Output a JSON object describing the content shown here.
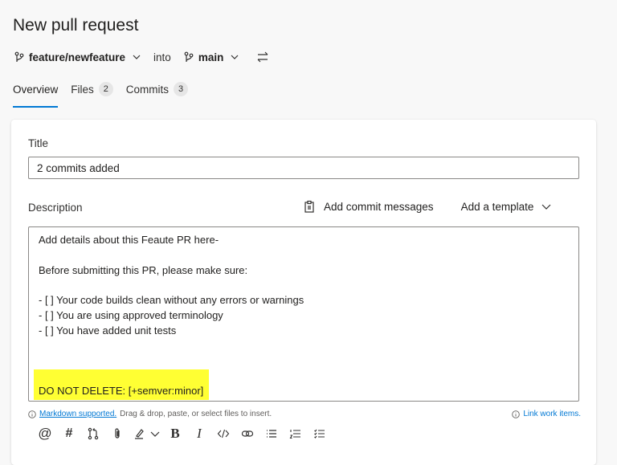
{
  "page": {
    "title": "New pull request"
  },
  "branches": {
    "source": "feature/newfeature",
    "into_label": "into",
    "target": "main"
  },
  "tabs": [
    {
      "label": "Overview",
      "active": true
    },
    {
      "label": "Files",
      "count": "2"
    },
    {
      "label": "Commits",
      "count": "3"
    }
  ],
  "form": {
    "title_label": "Title",
    "title_value": "2 commits added",
    "description_label": "Description",
    "add_commit_messages": "Add commit messages",
    "add_template": "Add a template",
    "description_lines": [
      "Add details about this Feaute PR here-",
      "",
      "Before submitting this PR, please make sure:",
      "",
      "- [ ] Your code builds clean without any errors or warnings",
      "- [ ] You are using approved terminology",
      "- [ ] You have added unit tests",
      "",
      "",
      "DO NOT DELETE: [+semver:minor]"
    ],
    "highlight_color": "#ffff33",
    "markdown_link": "Markdown supported.",
    "markdown_hint": "Drag & drop, paste, or select files to insert.",
    "link_work_items": "Link work items."
  },
  "toolbar": {
    "mention": "@",
    "hash": "#",
    "bold": "B",
    "italic": "I"
  },
  "colors": {
    "accent": "#0078d4",
    "highlight": "#ffff33"
  }
}
